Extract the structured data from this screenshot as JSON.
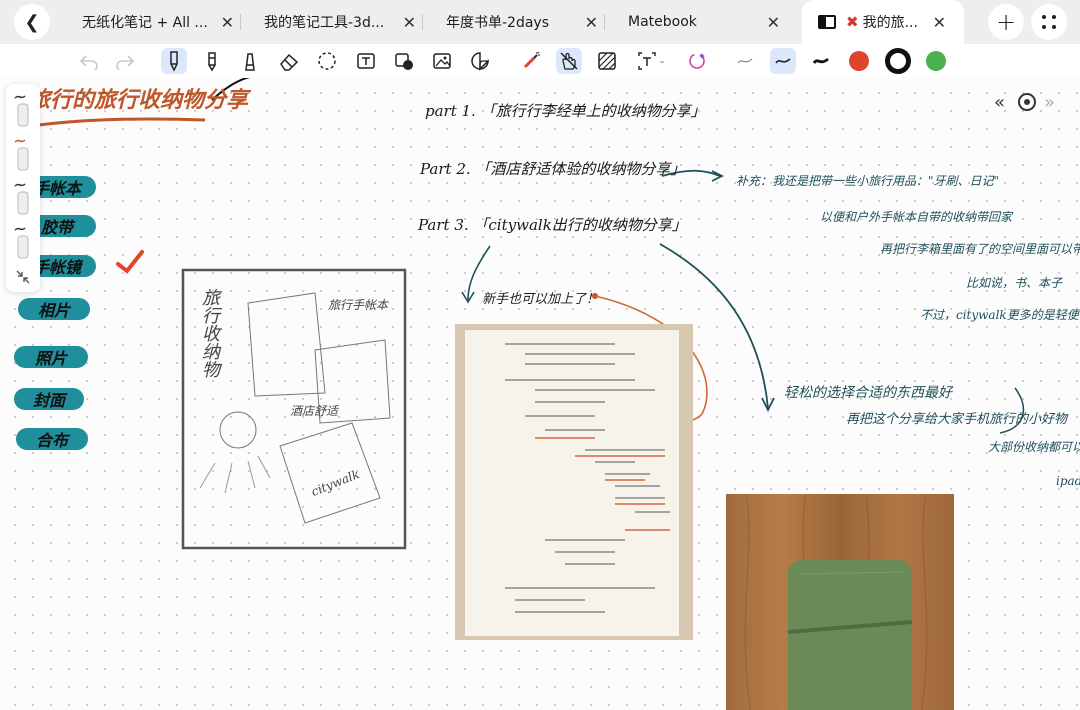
{
  "tabs": [
    {
      "label": "无纸化笔记 + All ...",
      "active": false
    },
    {
      "label": "我的笔记工具-3d...",
      "active": false
    },
    {
      "label": "年度书单-2days",
      "active": false
    },
    {
      "label": "Matebook",
      "active": false
    },
    {
      "label": "我的旅...",
      "active": true,
      "prefix_icon": "red-x-mark"
    }
  ],
  "colors": {
    "accent_blue": "#dbe7fb",
    "red": "#e0442b",
    "green": "#4caf50",
    "teal": "#1f8f9c",
    "ink_green": "#1f4f59"
  },
  "note": {
    "title": "旅行的旅行收纳物分享",
    "parts": [
      "part 1. 「旅行行李经单上的收纳物分享」",
      "Part 2. 「酒店舒适体验的收纳物分享」",
      "Part 3. 「citywalk出行的收纳物分享」"
    ],
    "left_pills": [
      "手帐本",
      "胶带",
      "手帐镜",
      "相片",
      "照片",
      "封面",
      "合布"
    ],
    "annotation_left": "新手也可以加上了！",
    "side_notes": [
      "补充：我还是把带一些小旅行用品：\"牙刷、日记\"",
      "以便和户外手帐本自带的收纳带回家",
      "再把行李箱里面有了的空间里面可以带一些小杂",
      "比如说，书、本子",
      "不过，citywalk更多的是轻便出行了"
    ],
    "bottom_notes": [
      "轻松的选择合适的东西最好",
      "再把这个分享给大家手机旅行的小好物",
      "大部份收纳都可以",
      "ipad"
    ],
    "sketch_labels": [
      "旅行收纳物",
      "旅行手帐本",
      "酒店舒适",
      "citywalk"
    ]
  }
}
